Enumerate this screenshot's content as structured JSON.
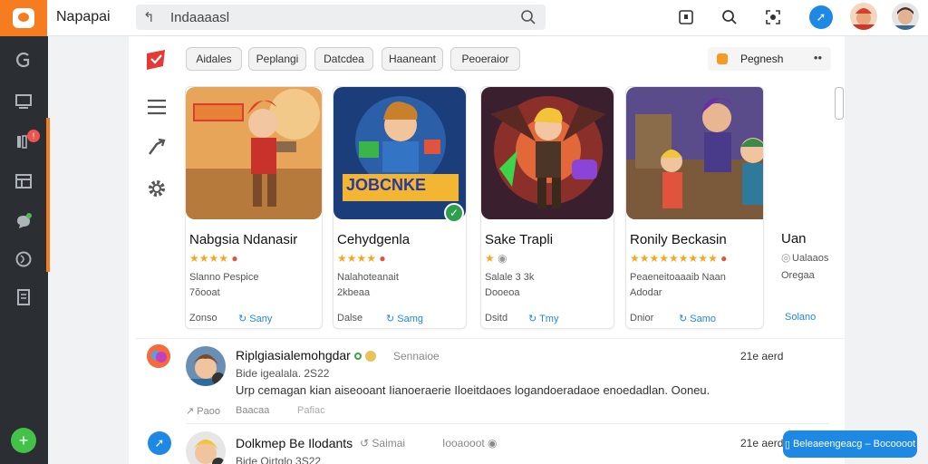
{
  "app": {
    "title": "Napapai"
  },
  "search": {
    "value": "Indaaaasl"
  },
  "colors": {
    "accent": "#f57c1f",
    "blue": "#1e88e5",
    "sidebar": "#2b2e33",
    "star": "#f5a623",
    "add": "#43c24a"
  },
  "icons": {
    "top": [
      "tablet-icon",
      "search-icon",
      "scan-icon",
      "share-icon"
    ],
    "sidebar": [
      "g-logo-icon",
      "monitor-icon",
      "library-icon",
      "layout-icon",
      "chat-icon",
      "globe-icon",
      "document-icon"
    ],
    "tools": [
      "flag-icon",
      "menu-icon",
      "arrow-icon",
      "gear-icon"
    ]
  },
  "filters": [
    "Aidales",
    "Peplangi",
    "Datcdea",
    "Haaneant",
    "Peoeraior"
  ],
  "sort": {
    "label": "Pegnesh",
    "more": "••"
  },
  "cards": [
    {
      "title": "Nabgsia Ndanasir",
      "rating": 4,
      "meta1": "Slanno Pespice",
      "meta2": "7ŏooat",
      "foot_left": "Zonso",
      "foot_right": "↻ Sany"
    },
    {
      "title": "Cehydgenla",
      "rating": 4,
      "meta1": "Nalahoteanait",
      "meta2": "2kbeaa",
      "foot_left": "Dalse",
      "foot_right": "↻ Samg",
      "thumb_text": "JOBCNKE"
    },
    {
      "title": "Sake Trapli",
      "rating": 1,
      "meta1": "Salale 3 3k",
      "meta2": "Dooeoa",
      "foot_left": "Dsitd",
      "foot_right": "↻ Tmy"
    },
    {
      "title": "Ronily Beckasin",
      "rating": 9,
      "meta1": "Peaeneitoaaaib Naan",
      "meta2": "Adodar",
      "foot_left": "Dnior",
      "foot_right": "↻ Samo"
    },
    {
      "title": "Uan",
      "rating": 0,
      "meta1": "Ualaaos",
      "meta2": "Oregaa",
      "foot_left": "",
      "foot_right": "Solano"
    }
  ],
  "feed": [
    {
      "title": "Riplgiasialemohgdar",
      "status": "Sennaioe",
      "sub": "Bide igealala. 2S22",
      "date": "21e aerd",
      "body": "Urp cemagan kian aiseooant Iianoeraerie Iloeitdaoes logandoeradaoe enoedadlan. Ooneu.",
      "action1": "Paoo",
      "action2": "Baacaa",
      "action3": "Pafiac"
    },
    {
      "title": "Dolkmep Be Ilodants",
      "status": "Saimai",
      "status2": "Iooaooot",
      "sub": "Bide Oirtglo 3S22",
      "date": "21e aerd"
    }
  ],
  "toast": {
    "label": "Beleaeengeacg – Bocoooot"
  }
}
